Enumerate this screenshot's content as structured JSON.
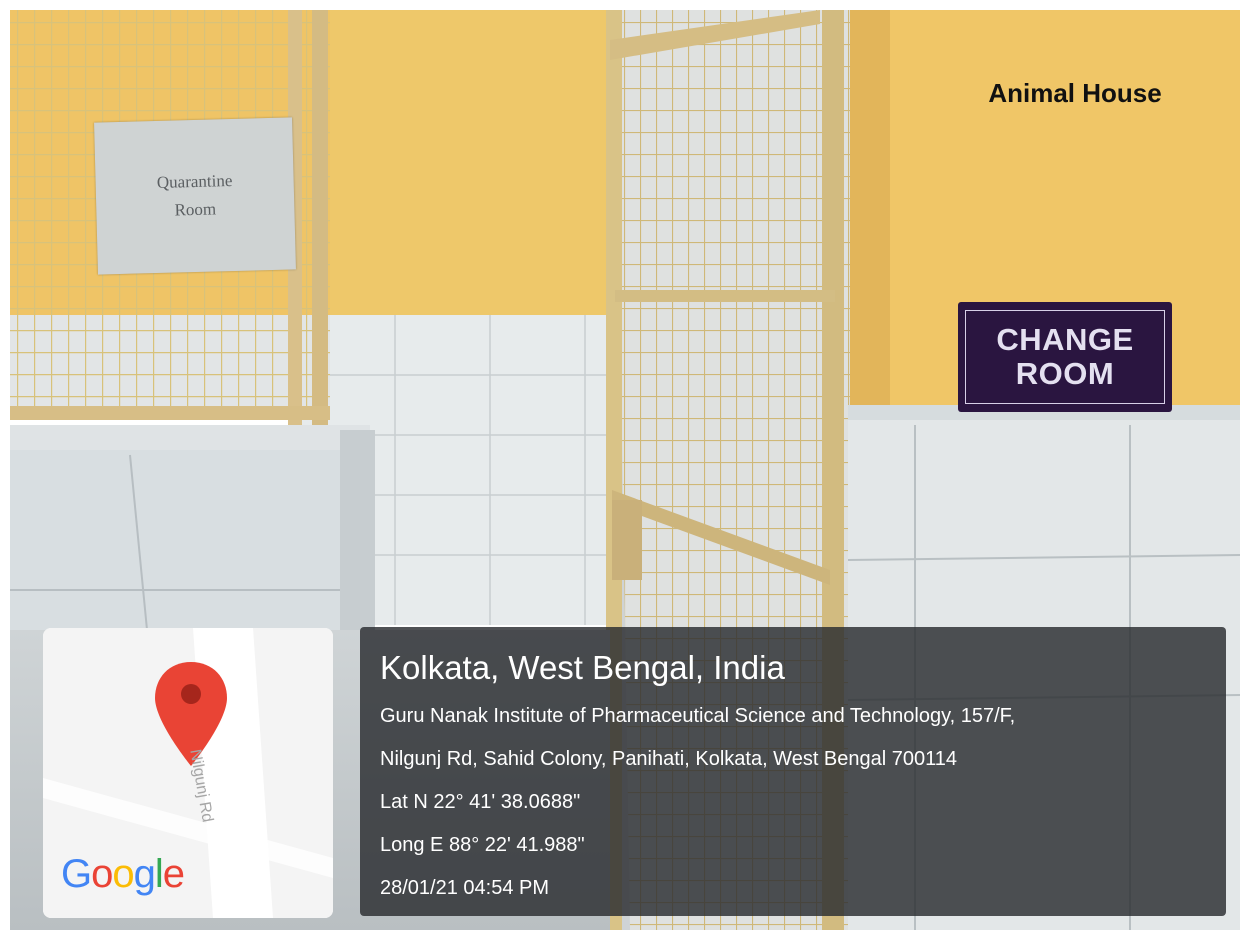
{
  "scene": {
    "wall_sign": "Animal House",
    "quarantine_sign": [
      "Quarantine",
      "Room"
    ],
    "change_room_sign": [
      "CHANGE",
      "ROOM"
    ]
  },
  "map": {
    "road_label": "Nilgunj Rd",
    "brand": [
      "G",
      "o",
      "o",
      "g",
      "l",
      "e"
    ],
    "brand_colors": [
      "#4285F4",
      "#EA4335",
      "#FBBC05",
      "#4285F4",
      "#34A853",
      "#EA4335"
    ],
    "pin_icon": "map-pin-icon"
  },
  "geotag": {
    "city": "Kolkata, West Bengal, India",
    "address_line1": "Guru Nanak Institute of Pharmaceutical Science and Technology, 157/F,",
    "address_line2": "Nilgunj Rd, Sahid Colony, Panihati, Kolkata, West Bengal 700114",
    "lat": "Lat N 22° 41' 38.0688\"",
    "long": "Long E 88° 22' 41.988\"",
    "timestamp": "28/01/21 04:54 PM"
  }
}
